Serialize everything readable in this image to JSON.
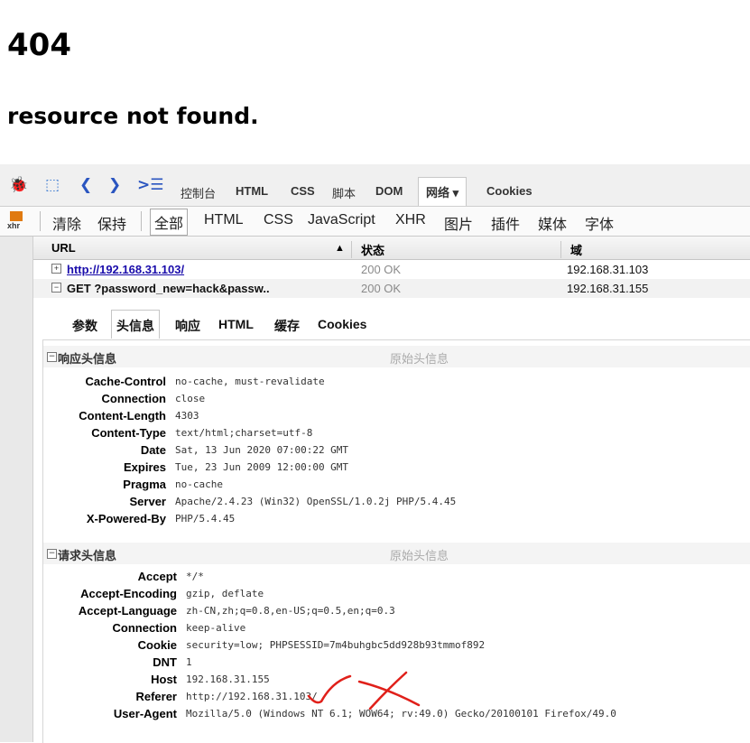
{
  "page": {
    "code": "404",
    "message": "resource not found."
  },
  "firebug": {
    "tabs": [
      "控制台",
      "HTML",
      "CSS",
      "脚本",
      "DOM",
      "网络 ▾",
      "Cookies"
    ],
    "filters": {
      "clear": "清除",
      "persist": "保持",
      "items": [
        "全部",
        "HTML",
        "CSS",
        "JavaScript",
        "XHR",
        "图片",
        "插件",
        "媒体",
        "字体"
      ]
    },
    "xhr_label": "xhr",
    "columns": {
      "url": "URL",
      "sort_arrow": "▲",
      "status": "状态",
      "domain": "域"
    },
    "requests": [
      {
        "toggle": "+",
        "url": "http://192.168.31.103/",
        "status": "200 OK",
        "domain": "192.168.31.103"
      },
      {
        "toggle": "−",
        "url": "GET ?password_new=hack&passw..",
        "status": "200 OK",
        "domain": "192.168.31.155"
      }
    ],
    "detail_tabs": [
      "参数",
      "头信息",
      "响应",
      "HTML",
      "缓存",
      "Cookies"
    ],
    "response_section": {
      "title": "响应头信息",
      "raw": "原始头信息"
    },
    "response_headers": [
      {
        "k": "Cache-Control",
        "v": "no-cache, must-revalidate"
      },
      {
        "k": "Connection",
        "v": "close"
      },
      {
        "k": "Content-Length",
        "v": "4303"
      },
      {
        "k": "Content-Type",
        "v": "text/html;charset=utf-8"
      },
      {
        "k": "Date",
        "v": "Sat, 13 Jun 2020 07:00:22 GMT"
      },
      {
        "k": "Expires",
        "v": "Tue, 23 Jun 2009 12:00:00 GMT"
      },
      {
        "k": "Pragma",
        "v": "no-cache"
      },
      {
        "k": "Server",
        "v": "Apache/2.4.23 (Win32) OpenSSL/1.0.2j PHP/5.4.45"
      },
      {
        "k": "X-Powered-By",
        "v": "PHP/5.4.45"
      }
    ],
    "request_section": {
      "title": "请求头信息",
      "raw": "原始头信息"
    },
    "request_headers": [
      {
        "k": "Accept",
        "v": "*/*"
      },
      {
        "k": "Accept-Encoding",
        "v": "gzip, deflate"
      },
      {
        "k": "Accept-Language",
        "v": "zh-CN,zh;q=0.8,en-US;q=0.5,en;q=0.3"
      },
      {
        "k": "Connection",
        "v": "keep-alive"
      },
      {
        "k": "Cookie",
        "v": "security=low; PHPSESSID=7m4buhgbc5dd928b93tmmof892"
      },
      {
        "k": "DNT",
        "v": "1"
      },
      {
        "k": "Host",
        "v": "192.168.31.155"
      },
      {
        "k": "Referer",
        "v": "http://192.168.31.103/"
      },
      {
        "k": "User-Agent",
        "v": "Mozilla/5.0 (Windows NT 6.1; WOW64; rv:49.0) Gecko/20100101 Firefox/49.0"
      }
    ],
    "colors": {
      "link": "#1a0dab",
      "annotation": "#e0201a"
    }
  }
}
